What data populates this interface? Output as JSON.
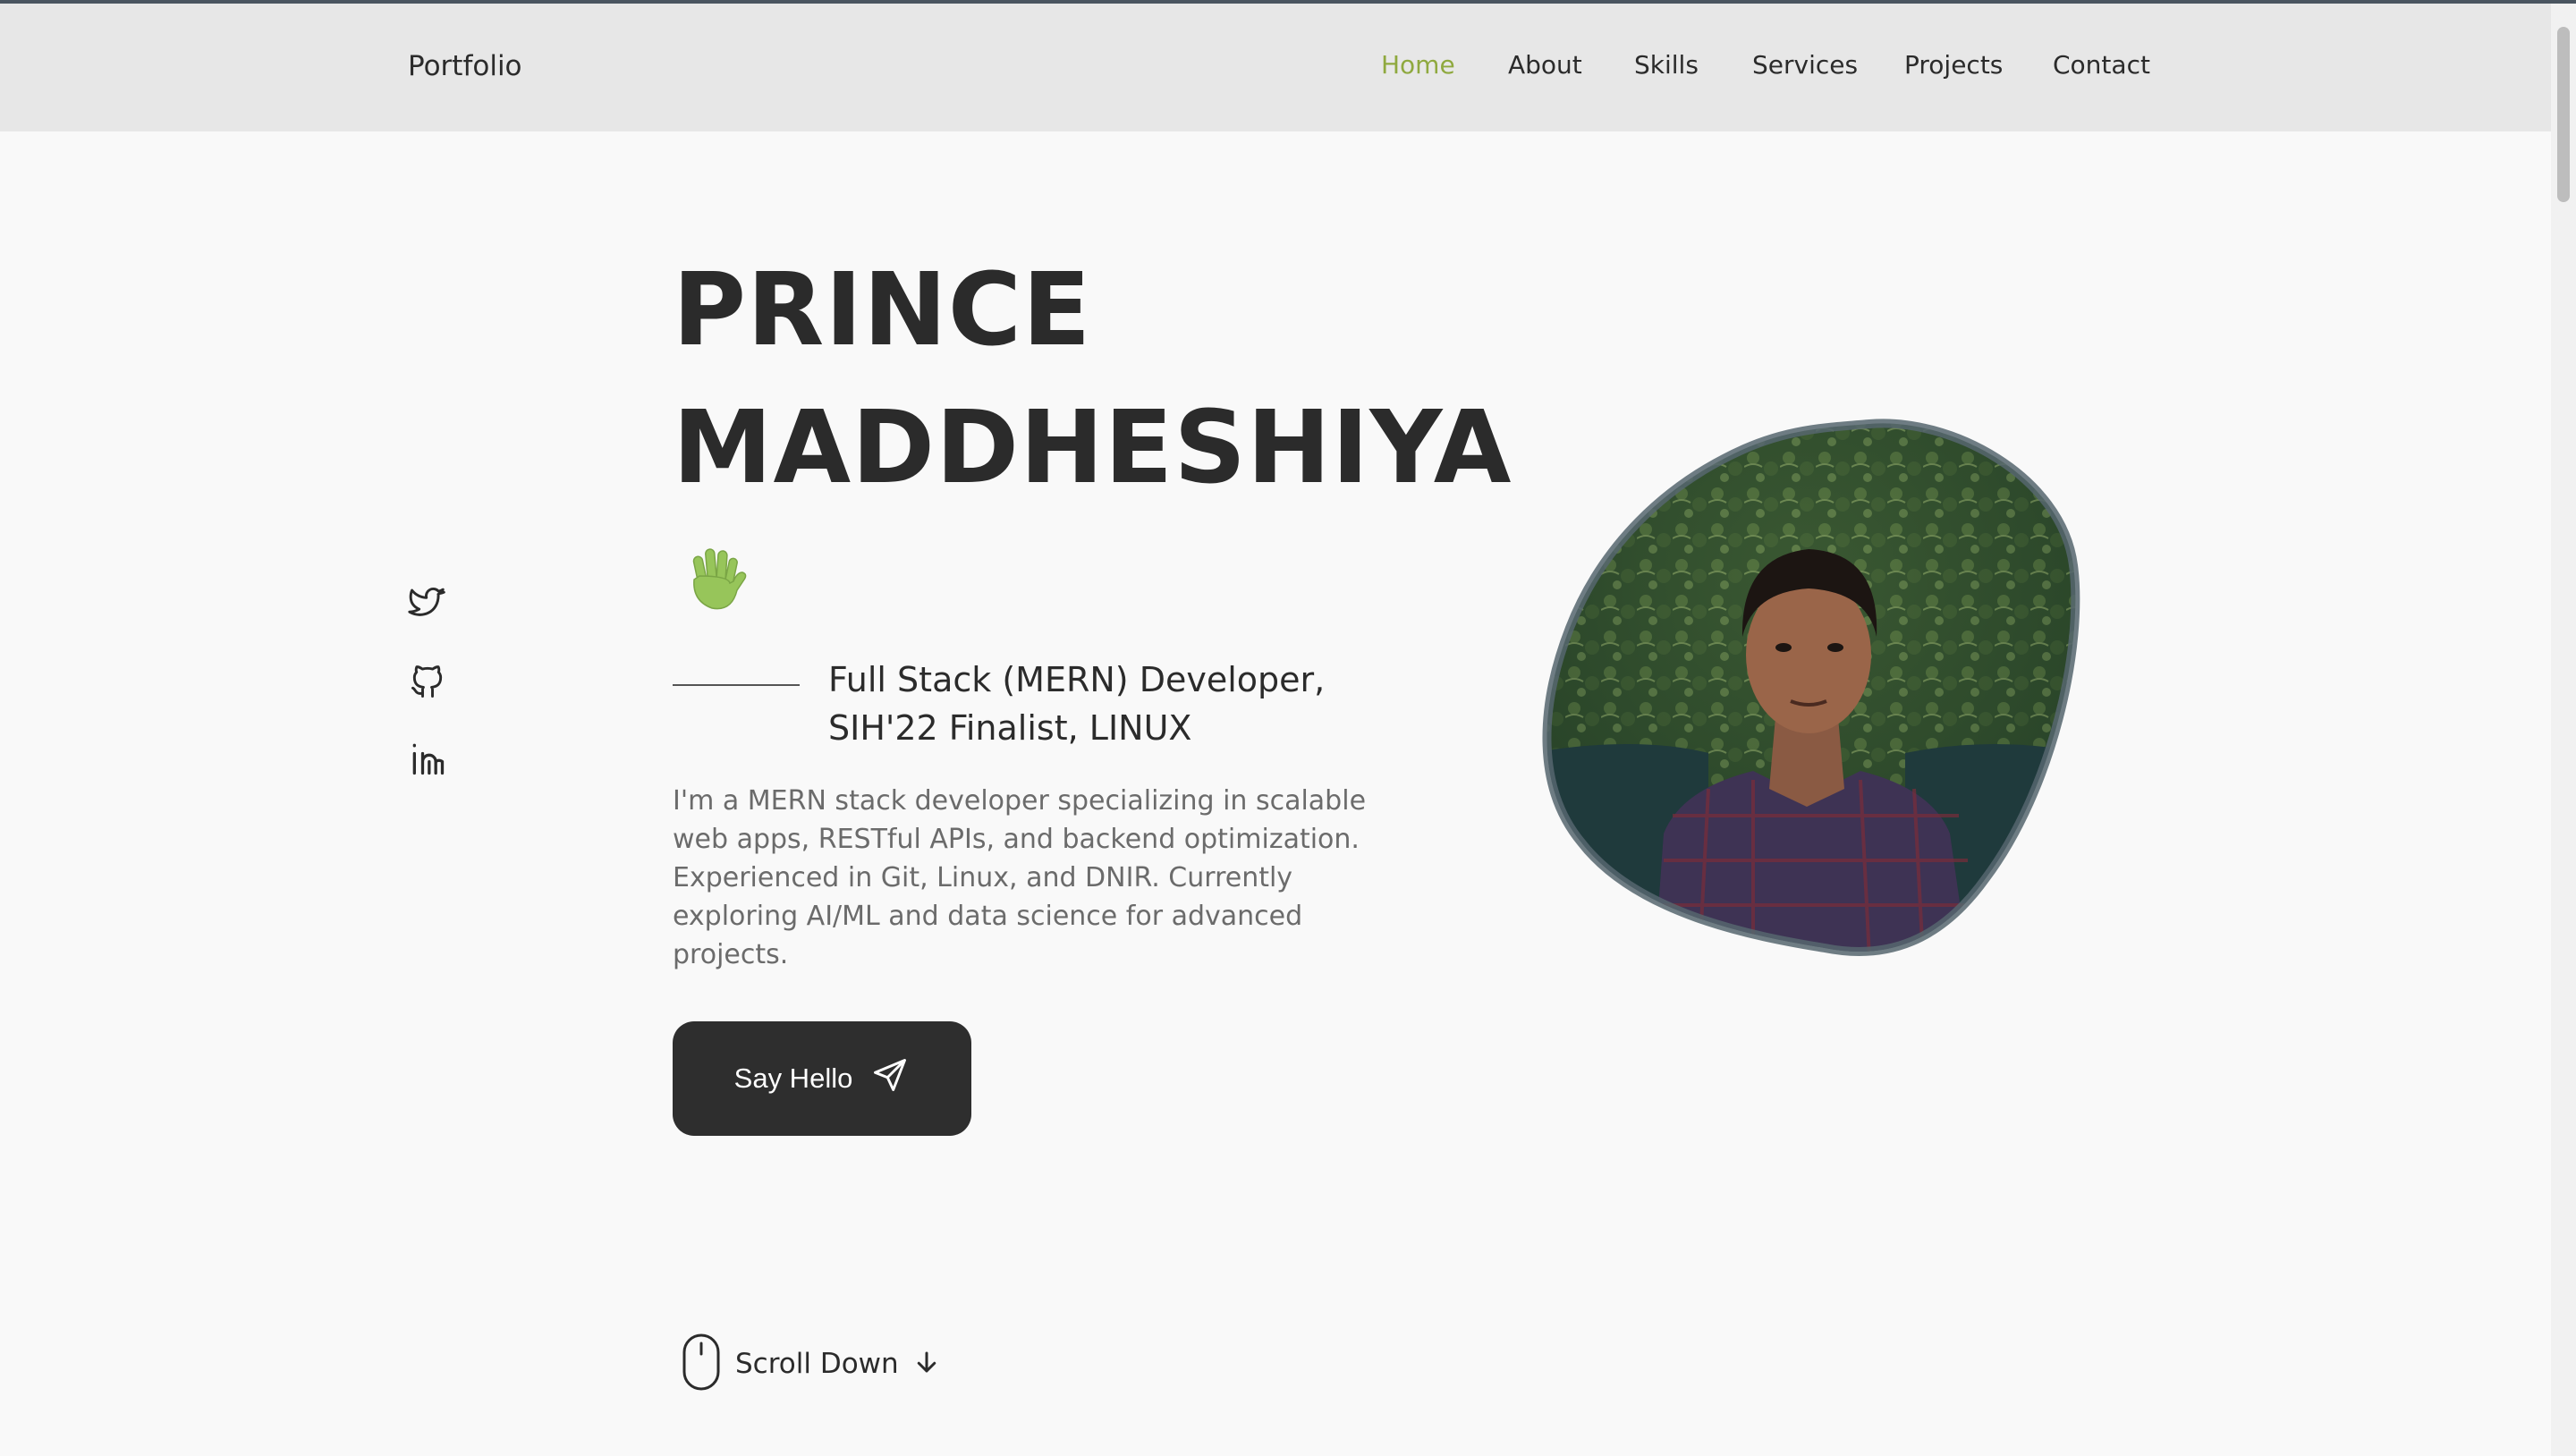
{
  "header": {
    "logo": "Portfolio",
    "nav": [
      {
        "label": "Home",
        "active": true
      },
      {
        "label": "About",
        "active": false
      },
      {
        "label": "Skills",
        "active": false
      },
      {
        "label": "Services",
        "active": false
      },
      {
        "label": "Projects",
        "active": false
      },
      {
        "label": "Contact",
        "active": false
      }
    ]
  },
  "social": [
    {
      "icon": "twitter-icon"
    },
    {
      "icon": "github-icon"
    },
    {
      "icon": "linkedin-icon"
    }
  ],
  "hero": {
    "name_line1": "PRINCE",
    "name_line2": "MADDHESHIYA",
    "wave_icon": "waving-hand-icon",
    "subtitle_line1": "Full Stack (MERN) Developer,",
    "subtitle_line2": "SIH'22 Finalist, LINUX",
    "description": "I'm a MERN stack developer specializing in scalable web apps, RESTful APIs, and backend optimization. Experienced in Git, Linux, and DNIR. Currently exploring AI/ML and data science for advanced projects.",
    "cta_label": "Say Hello",
    "cta_icon": "send-icon",
    "scroll_label": "Scroll Down",
    "scroll_icon": "mouse-icon"
  },
  "colors": {
    "accent": "#8fa93f",
    "dark": "#2e2e2e",
    "header_bg": "#e7e7e7",
    "page_bg": "#f9f9f9"
  }
}
